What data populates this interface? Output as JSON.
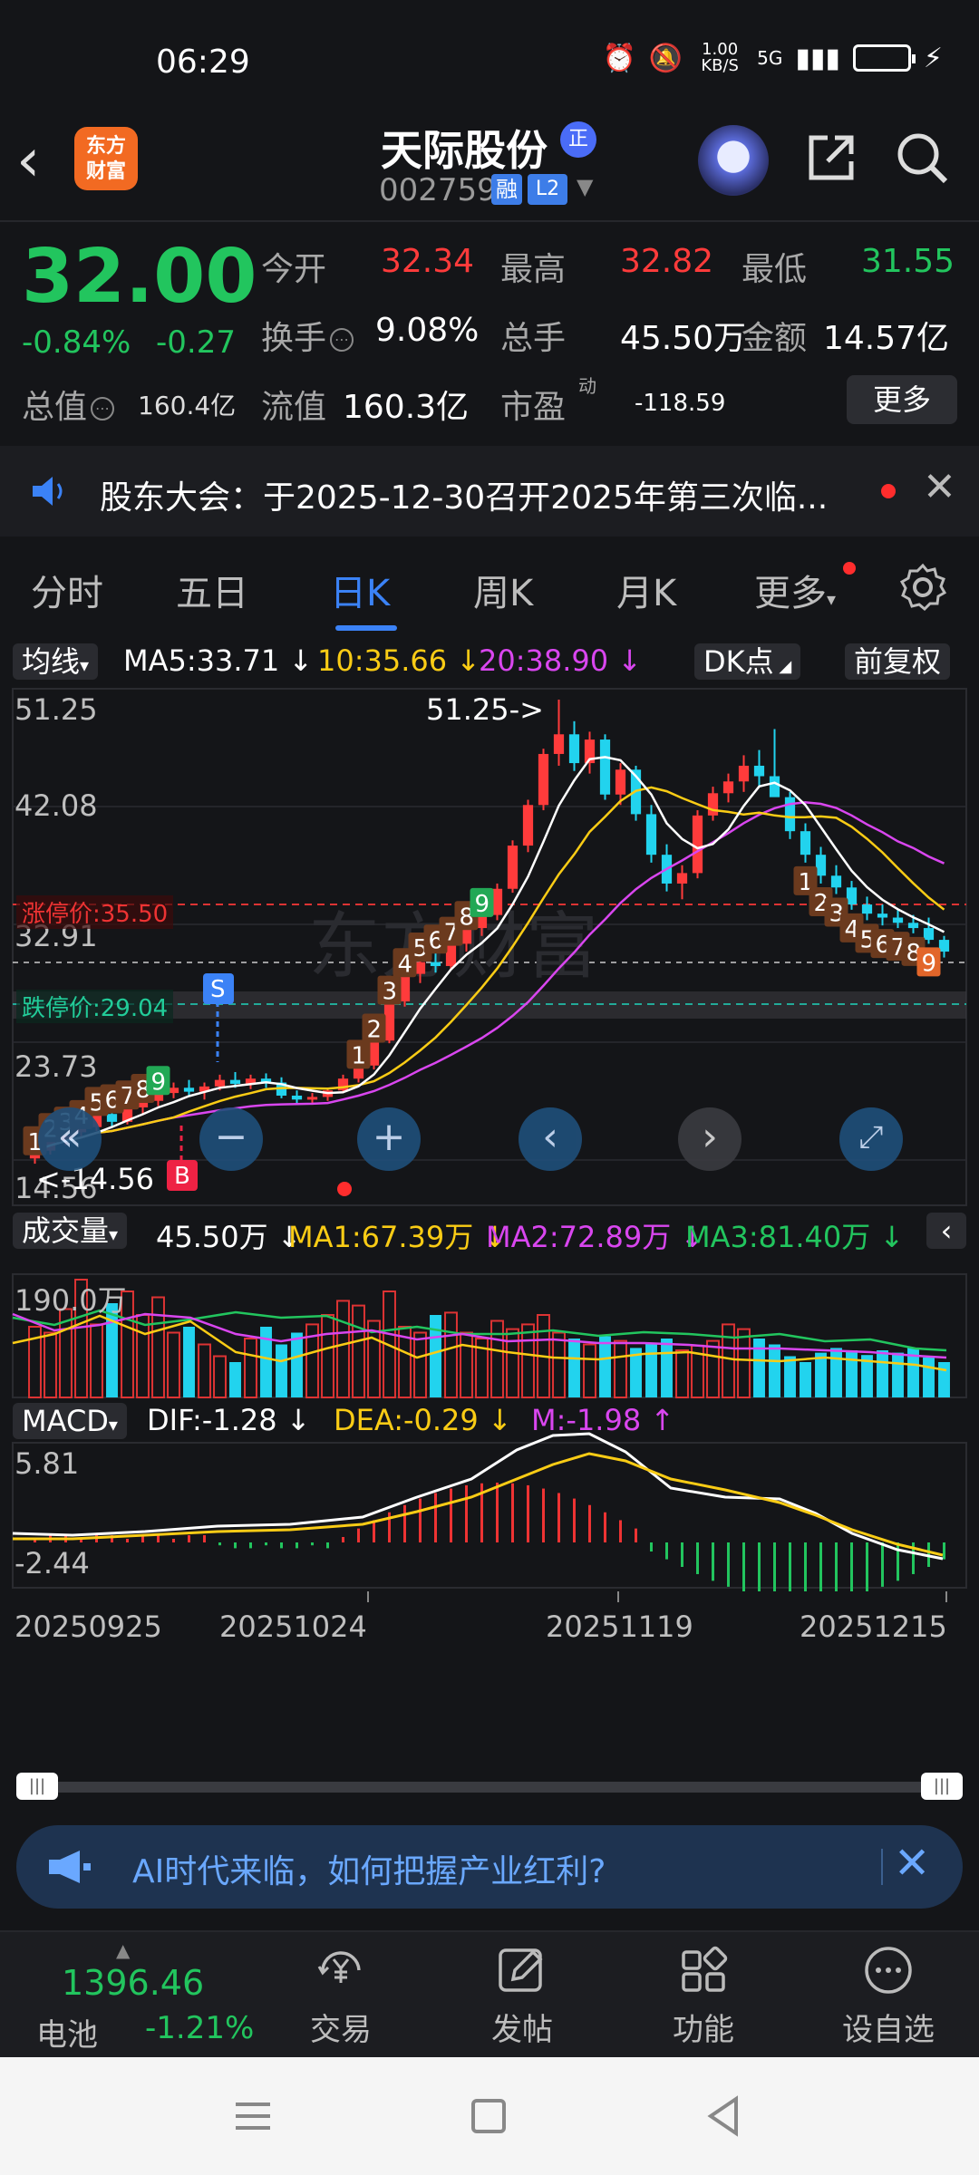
{
  "status": {
    "time": "06:29",
    "net_speed": "1.00 KB/S",
    "net_type": "5G"
  },
  "header": {
    "logo_line1": "东方",
    "logo_line2": "财富",
    "stock_name": "天际股份",
    "name_badge": "正",
    "stock_code": "002759",
    "badge_rong": "融",
    "badge_l2": "L2"
  },
  "quote": {
    "price": "32.00",
    "pct_change": "-0.84%",
    "abs_change": "-0.27",
    "open_label": "今开",
    "open": "32.34",
    "high_label": "最高",
    "high": "32.82",
    "low_label": "最低",
    "low": "31.55",
    "turnover_label": "换手",
    "turnover": "9.08%",
    "volume_label": "总手",
    "volume": "45.50万",
    "amount_label": "金额",
    "amount": "14.57亿",
    "total_value_label": "总值",
    "total_value": "160.4亿",
    "float_value_label": "流值",
    "float_value": "160.3亿",
    "pe_label": "市盈",
    "pe_sup": "动",
    "pe": "-118.59",
    "more_label": "更多"
  },
  "announcement": {
    "text": "股东大会：于2025-12-30召开2025年第三次临..."
  },
  "tabs": [
    {
      "label": "分时"
    },
    {
      "label": "五日"
    },
    {
      "label": "日K"
    },
    {
      "label": "周K"
    },
    {
      "label": "月K"
    },
    {
      "label": "更多"
    }
  ],
  "kline": {
    "indicator_chip": "均线",
    "ma5": "MA5:33.71",
    "ma10": "10:35.66",
    "ma20": "20:38.90",
    "dk_chip": "DK点",
    "fq_chip": "前复权",
    "y_top": "51.25",
    "y_2": "42.08",
    "y_3": "32.91",
    "y_4": "23.73",
    "y_bottom": "14.56",
    "peak_label": "51.25->",
    "low_label": "<-14.56",
    "limit_up_label": "涨停价:35.50",
    "limit_down_label": "跌停价:29.04",
    "sell_marker": "S",
    "buy_marker": "B",
    "watermark": "东方财富",
    "seq_left": [
      "1",
      "2",
      "3",
      "4",
      "5",
      "6",
      "7",
      "8",
      "9"
    ],
    "seq_mid": [
      "1",
      "2",
      "3",
      "4",
      "5",
      "6",
      "7",
      "8",
      "9"
    ],
    "seq_right": [
      "1",
      "2",
      "3",
      "4",
      "5",
      "6",
      "7",
      "8",
      "9"
    ]
  },
  "chart_data": {
    "type": "candlestick",
    "ylim": [
      14.56,
      51.25
    ],
    "x_ticks": [
      "20250925",
      "20251024",
      "20251119",
      "20251215"
    ],
    "candles": [
      [
        16.2,
        17.0,
        15.8,
        16.8
      ],
      [
        16.8,
        18.0,
        16.5,
        17.6
      ],
      [
        17.6,
        18.5,
        17.2,
        18.2
      ],
      [
        18.2,
        19.0,
        17.8,
        18.6
      ],
      [
        18.6,
        20.0,
        18.3,
        19.6
      ],
      [
        19.6,
        20.2,
        18.6,
        19.0
      ],
      [
        19.0,
        20.5,
        18.8,
        20.1
      ],
      [
        20.1,
        21.0,
        19.6,
        20.6
      ],
      [
        20.6,
        21.6,
        20.2,
        21.2
      ],
      [
        21.2,
        22.0,
        20.8,
        21.6
      ],
      [
        21.6,
        22.2,
        20.9,
        21.3
      ],
      [
        21.3,
        22.0,
        20.7,
        21.7
      ],
      [
        21.7,
        22.6,
        21.4,
        22.2
      ],
      [
        22.2,
        22.8,
        21.6,
        21.9
      ],
      [
        21.9,
        22.6,
        21.5,
        22.3
      ],
      [
        22.3,
        22.7,
        21.6,
        22.0
      ],
      [
        22.0,
        22.4,
        20.8,
        21.0
      ],
      [
        21.0,
        21.4,
        20.4,
        20.7
      ],
      [
        20.7,
        21.2,
        20.3,
        20.9
      ],
      [
        20.9,
        21.6,
        20.6,
        21.4
      ],
      [
        21.4,
        22.6,
        21.2,
        22.3
      ],
      [
        22.3,
        23.6,
        22.0,
        23.3
      ],
      [
        23.3,
        25.6,
        23.0,
        25.2
      ],
      [
        25.2,
        28.5,
        25.0,
        28.2
      ],
      [
        28.2,
        30.6,
        27.8,
        30.3
      ],
      [
        30.3,
        31.8,
        29.6,
        31.2
      ],
      [
        31.2,
        32.4,
        30.4,
        30.9
      ],
      [
        30.9,
        33.0,
        30.6,
        32.6
      ],
      [
        32.6,
        34.2,
        32.0,
        33.8
      ],
      [
        33.8,
        35.2,
        33.2,
        34.8
      ],
      [
        34.8,
        37.2,
        34.4,
        36.8
      ],
      [
        36.8,
        40.5,
        36.5,
        40.1
      ],
      [
        40.1,
        43.6,
        39.6,
        43.2
      ],
      [
        43.2,
        47.5,
        42.8,
        47.1
      ],
      [
        47.1,
        51.25,
        46.2,
        48.6
      ],
      [
        48.6,
        49.6,
        45.8,
        46.4
      ],
      [
        46.4,
        48.8,
        45.6,
        48.2
      ],
      [
        48.2,
        48.6,
        43.6,
        44.0
      ],
      [
        44.0,
        46.4,
        43.2,
        45.9
      ],
      [
        45.9,
        46.2,
        42.0,
        42.5
      ],
      [
        42.5,
        43.2,
        38.8,
        39.4
      ],
      [
        39.4,
        40.2,
        36.6,
        37.2
      ],
      [
        37.2,
        38.6,
        36.0,
        38.0
      ],
      [
        38.0,
        42.8,
        37.6,
        42.4
      ],
      [
        42.4,
        44.6,
        42.0,
        44.1
      ],
      [
        44.1,
        45.6,
        43.4,
        45.0
      ],
      [
        45.0,
        47.0,
        44.2,
        46.2
      ],
      [
        46.2,
        47.4,
        44.6,
        45.4
      ],
      [
        45.4,
        49.0,
        44.8,
        43.8
      ],
      [
        43.8,
        44.2,
        40.6,
        41.2
      ],
      [
        41.2,
        41.8,
        38.8,
        39.4
      ],
      [
        39.4,
        40.0,
        37.2,
        37.8
      ],
      [
        37.8,
        38.6,
        36.4,
        36.9
      ],
      [
        36.9,
        37.4,
        35.2,
        35.6
      ],
      [
        35.6,
        36.2,
        34.4,
        34.9
      ],
      [
        34.9,
        35.6,
        34.0,
        34.6
      ],
      [
        34.6,
        35.2,
        33.8,
        34.2
      ],
      [
        34.2,
        34.8,
        33.4,
        33.8
      ],
      [
        33.8,
        34.6,
        32.6,
        32.9
      ],
      [
        32.9,
        33.2,
        31.55,
        32.0
      ]
    ],
    "volume": {
      "label": "成交量",
      "current": "45.50万",
      "ma1": "MA1:67.39万",
      "ma2": "MA2:72.89万",
      "ma3": "MA3:81.40万",
      "y_top": "190.0万"
    },
    "macd": {
      "label": "MACD",
      "dif": "DIF:-1.28",
      "dea": "DEA:-0.29",
      "m": "M:-1.98",
      "y_top": "5.81",
      "y_bottom": "-2.44"
    }
  },
  "colors": {
    "up": "#ff3b3b",
    "down": "#22d3ee",
    "ma5": "#ffffff",
    "ma10": "#facc15",
    "ma20": "#d946ef",
    "accent": "#3b82f6"
  },
  "ai_banner": {
    "text": "AI时代来临，如何把握产业红利?"
  },
  "bottom_bar": {
    "index_value": "1396.46",
    "index_name": "电池",
    "index_change": "-1.21%",
    "items": [
      {
        "label": "交易",
        "icon": "yen-coin-icon"
      },
      {
        "label": "发帖",
        "icon": "edit-post-icon"
      },
      {
        "label": "功能",
        "icon": "grid-apps-icon"
      },
      {
        "label": "设自选",
        "icon": "more-dots-icon"
      }
    ]
  }
}
